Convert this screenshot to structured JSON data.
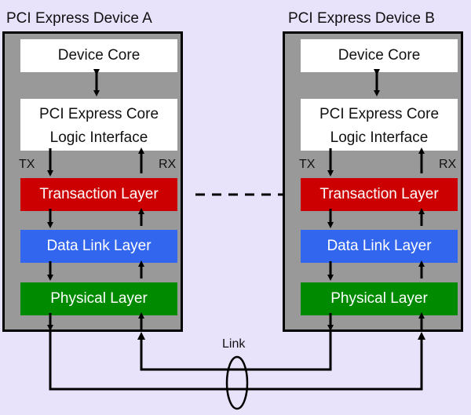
{
  "devices": [
    {
      "title": "PCI Express Device A",
      "device_core": "Device Core",
      "pcie_core_line1": "PCI Express Core",
      "pcie_core_line2": "Logic Interface",
      "tx": "TX",
      "rx": "RX",
      "transaction_layer": "Transaction Layer",
      "data_link_layer": "Data Link Layer",
      "physical_layer": "Physical Layer"
    },
    {
      "title": "PCI Express Device B",
      "device_core": "Device Core",
      "pcie_core_line1": "PCI Express Core",
      "pcie_core_line2": "Logic Interface",
      "tx": "TX",
      "rx": "RX",
      "transaction_layer": "Transaction Layer",
      "data_link_layer": "Data Link Layer",
      "physical_layer": "Physical Layer"
    }
  ],
  "link_label": "Link",
  "colors": {
    "background": "#e8e2fb",
    "device_fill": "#999999",
    "transaction_layer": "#cc0000",
    "data_link_layer": "#3366ee",
    "physical_layer": "#008a00"
  }
}
